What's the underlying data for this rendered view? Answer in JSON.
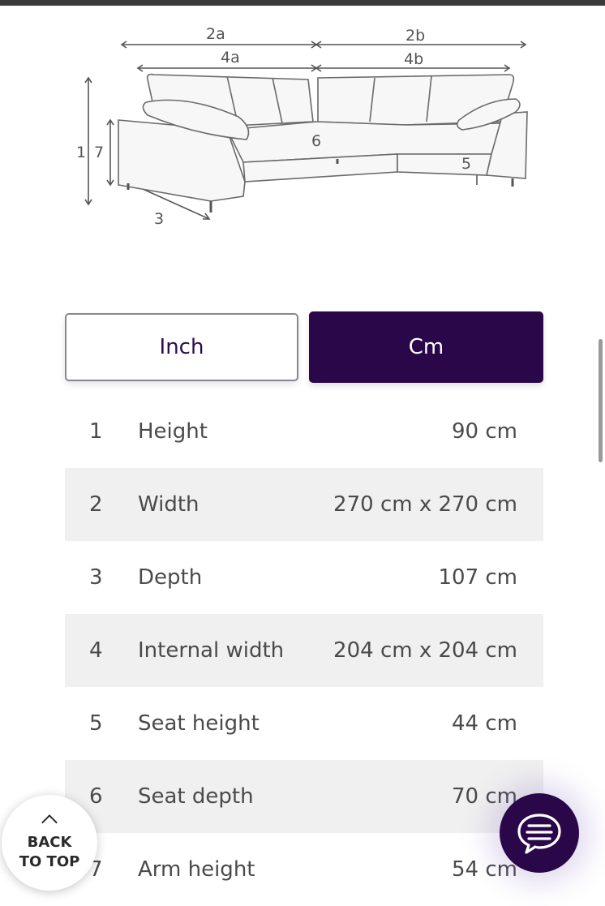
{
  "diagram": {
    "labels": {
      "top_a": "2a",
      "top_b": "2b",
      "inner_a": "4a",
      "inner_b": "4b",
      "height_1": "1",
      "height_7": "7",
      "depth": "3",
      "seat_height": "5",
      "seat_depth": "6"
    }
  },
  "unit_toggle": {
    "inch_label": "Inch",
    "cm_label": "Cm",
    "selected": "Cm"
  },
  "dimensions": [
    {
      "num": "1",
      "name": "Height",
      "value": "90 cm"
    },
    {
      "num": "2",
      "name": "Width",
      "value": "270 cm x 270 cm"
    },
    {
      "num": "3",
      "name": "Depth",
      "value": "107 cm"
    },
    {
      "num": "4",
      "name": "Internal width",
      "value": "204 cm x 204 cm"
    },
    {
      "num": "5",
      "name": "Seat height",
      "value": "44 cm"
    },
    {
      "num": "6",
      "name": "Seat depth",
      "value": "70 cm"
    },
    {
      "num": "7",
      "name": "Arm height",
      "value": "54 cm"
    }
  ],
  "back_to_top": {
    "line1": "BACK",
    "line2": "TO TOP"
  },
  "colors": {
    "brand_purple": "#2a0749",
    "row_alt": "#f0f0f0"
  },
  "icons": {
    "back_to_top": "chevron-up-icon",
    "chat": "chat-bubble-icon"
  }
}
